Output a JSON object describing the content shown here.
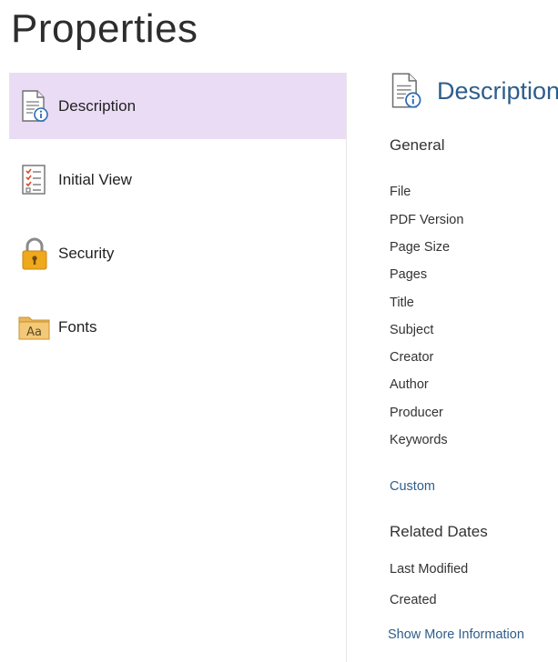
{
  "page": {
    "title": "Properties"
  },
  "sidebar": {
    "items": [
      {
        "label": "Description",
        "icon": "document-info-icon",
        "active": true
      },
      {
        "label": "Initial View",
        "icon": "checklist-icon",
        "active": false
      },
      {
        "label": "Security",
        "icon": "lock-icon",
        "active": false
      },
      {
        "label": "Fonts",
        "icon": "font-folder-icon",
        "active": false
      }
    ]
  },
  "content": {
    "title": "Description",
    "title_icon": "document-info-icon",
    "general_heading": "General",
    "fields": [
      "File",
      "PDF Version",
      "Page Size",
      "Pages",
      "Title",
      "Subject",
      "Creator",
      "Author",
      "Producer",
      "Keywords"
    ],
    "custom_link": "Custom",
    "related_dates_heading": "Related Dates",
    "date_fields": [
      "Last Modified",
      "Created"
    ],
    "show_more_link": "Show More Information"
  },
  "colors": {
    "active_bg": "#eadcf5",
    "link": "#2f5d8a",
    "lock": "#f0a81c",
    "folder": "#e8b65a"
  }
}
